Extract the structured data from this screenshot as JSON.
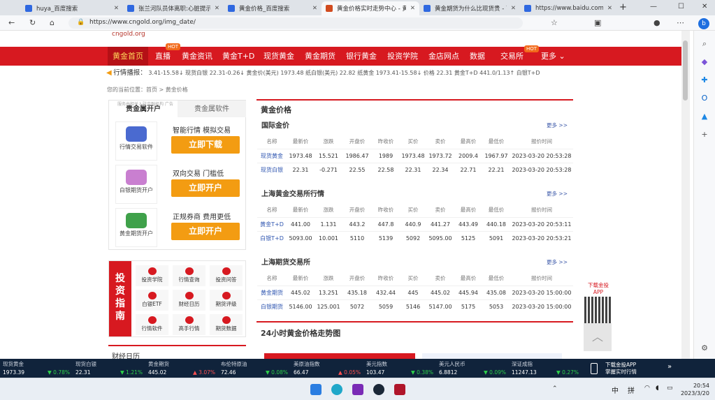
{
  "browser": {
    "tabs": [
      {
        "label": "huya_百度搜索",
        "color": "#2f68e0"
      },
      {
        "label": "张兰河队员体离职:心脏提示...",
        "color": "#2f68e0"
      },
      {
        "label": "黄金价格_百度搜索",
        "color": "#2f68e0"
      },
      {
        "label": "黄金价格实时走势中心 - 黄...",
        "color": "#d14b1f"
      },
      {
        "label": "黄金期货为什么比现货贵 - 百...",
        "color": "#2f68e0"
      },
      {
        "label": "https://www.baidu.com/lin...",
        "color": "#2f68e0"
      }
    ],
    "active_tab": 3,
    "url": "https://www.cngold.org/img_date/",
    "new_tab_symbol": "+",
    "window_controls": [
      "—",
      "☐",
      "✕"
    ]
  },
  "site": {
    "logo_text": "cngold.org",
    "nav": {
      "home": "黄金首页",
      "items": [
        "直播",
        "黄金资讯",
        "黄金T+D",
        "现货黄金",
        "黄金期货",
        "银行黄金",
        "投资学院",
        "金店网点",
        "数据",
        "交易所",
        "更多"
      ],
      "hot_badge": "HOT"
    },
    "ticker": {
      "title": "行情播报：",
      "text": "3.41-15.58↓   现货白银 22.31-0.26↓   黄金价(美元) 1973.48   纸白银(美元) 22.82   纸黄金 1973.41-15.58↓   价格 22.31   黄金T+D 441.0/1.13↑   白银T+D"
    },
    "breadcrumb": "您的当前位置：首页 > 黄金价格",
    "accounts": {
      "tabs": [
        "贵金属开户",
        "贵金属软件"
      ],
      "ad_note": "服务由相关入驻金融机构 广告",
      "rows": [
        {
          "icon_label": "行情交易软件",
          "tagline": "智能行情 模拟交易",
          "cta": "立即下载",
          "color": "#4a6ad0"
        },
        {
          "icon_label": "白银期货开户",
          "tagline": "双向交易 门槛低",
          "cta": "立即开户",
          "color": "#c97fd0"
        },
        {
          "icon_label": "黄金期货开户",
          "tagline": "正规券商 费用更低",
          "cta": "立即开户",
          "color": "#3fa14a"
        }
      ]
    },
    "guide": {
      "title": "投资指南",
      "items": [
        {
          "label": "投资学院",
          "color": "#d71920"
        },
        {
          "label": "行情查询",
          "color": "#d71920"
        },
        {
          "label": "投资问答",
          "color": "#d71920"
        },
        {
          "label": "白银ETF",
          "color": "#d71920"
        },
        {
          "label": "财经日历",
          "color": "#d71920"
        },
        {
          "label": "期货评级",
          "color": "#d71920"
        },
        {
          "label": "行情软件",
          "color": "#d71920"
        },
        {
          "label": "高手行情",
          "color": "#d71920"
        },
        {
          "label": "期货数据",
          "color": "#d71920"
        }
      ]
    },
    "calendar_title": "财经日历",
    "gold_price_title": "黄金价格",
    "more_label": "更多 >>",
    "sections": [
      {
        "title": "国际金价",
        "headers": [
          "名称",
          "最新价",
          "涨跌",
          "开盘价",
          "昨收价",
          "买价",
          "卖价",
          "最高价",
          "最低价",
          "报价时间"
        ],
        "rows": [
          {
            "cells": [
              "现货黄金",
              "1973.48",
              "15.521",
              "1986.47",
              "1989",
              "1973.48",
              "1973.72",
              "2009.4",
              "1967.97",
              "2023-03-20 20:53:28"
            ],
            "dir": "down"
          },
          {
            "cells": [
              "现货白银",
              "22.31",
              "-0.271",
              "22.55",
              "22.58",
              "22.31",
              "22.34",
              "22.71",
              "22.21",
              "2023-03-20 20:53:28"
            ],
            "dir": "down"
          }
        ]
      },
      {
        "title": "上海黄金交易所行情",
        "headers": [
          "名称",
          "最新价",
          "涨跌",
          "开盘价",
          "昨收价",
          "买价",
          "卖价",
          "最高价",
          "最低价",
          "报价时间"
        ],
        "rows": [
          {
            "cells": [
              "黄金T+D",
              "441.00",
              "1.131",
              "443.2",
              "447.8",
              "440.9",
              "441.27",
              "443.49",
              "440.18",
              "2023-03-20 20:53:11"
            ],
            "dir": "up"
          },
          {
            "cells": [
              "白银T+D",
              "5093.00",
              "10.001",
              "5110",
              "5139",
              "5092",
              "5095.00",
              "5125",
              "5091",
              "2023-03-20 20:53:21"
            ],
            "dir": "up"
          }
        ]
      },
      {
        "title": "上海期货交易所",
        "headers": [
          "名称",
          "最新价",
          "涨跌",
          "开盘价",
          "昨收价",
          "买价",
          "卖价",
          "最高价",
          "最低价",
          "报价时间"
        ],
        "rows": [
          {
            "cells": [
              "黄金期货",
              "445.02",
              "13.251",
              "435.18",
              "432.44",
              "445",
              "445.02",
              "445.94",
              "435.08",
              "2023-03-20 15:00:00"
            ],
            "dir": "up"
          },
          {
            "cells": [
              "白银期货",
              "5146.00",
              "125.001",
              "5072",
              "5059",
              "5146",
              "5147.00",
              "5175",
              "5053",
              "2023-03-20 15:00:00"
            ],
            "dir": "up"
          }
        ]
      }
    ],
    "chart24_title": "24小时黄金价格走势图",
    "qr_label": "下载金投APP",
    "to_top": "︿"
  },
  "stockbar": [
    {
      "name": "现货黄金",
      "value": "1973.39",
      "pct": "0.78%",
      "dir": "dn"
    },
    {
      "name": "现货白银",
      "value": "22.31",
      "pct": "1.21%",
      "dir": "dn"
    },
    {
      "name": "黄金期货",
      "value": "445.02",
      "pct": "3.07%",
      "dir": "up"
    },
    {
      "name": "布伦特原油",
      "value": "72.46",
      "pct": "0.08%",
      "dir": "dn"
    },
    {
      "name": "美原油指数",
      "value": "66.47",
      "pct": "0.05%",
      "dir": "up"
    },
    {
      "name": "美元指数",
      "value": "103.47",
      "pct": "0.38%",
      "dir": "dn"
    },
    {
      "name": "美元人民币",
      "value": "6.8812",
      "pct": "0.09%",
      "dir": "dn"
    },
    {
      "name": "深证成指",
      "value": "11247.13",
      "pct": "0.27%",
      "dir": "dn"
    }
  ],
  "stockbar_app": {
    "line1": "下载金投APP",
    "line2": "掌握实时行情"
  },
  "taskbar": {
    "time": "20:54",
    "date": "2023/3/20",
    "ime": "中",
    "ime2": "拼"
  }
}
